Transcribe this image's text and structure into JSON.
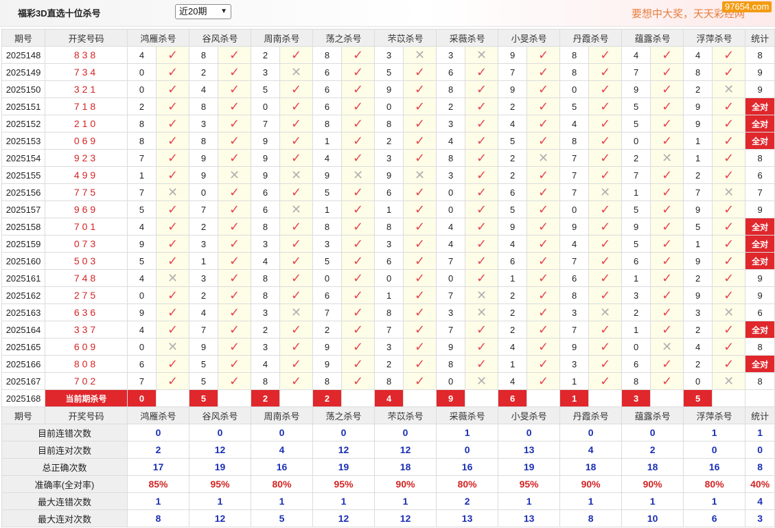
{
  "header": {
    "title": "福彩3D直选十位杀号",
    "period_select": "近20期",
    "slogan": "要想中大奖，天天彩经网",
    "site_badge": "97654.com"
  },
  "columns": {
    "period": "期号",
    "draw": "开奖号码",
    "experts": [
      "鸿雁杀号",
      "谷风杀号",
      "周南杀号",
      "荡之杀号",
      "芣苡杀号",
      "采薇杀号",
      "小旻杀号",
      "丹霞杀号",
      "蕴露杀号",
      "浮萍杀号"
    ],
    "total": "统计"
  },
  "marks": {
    "ok": "✓",
    "ng": "✕"
  },
  "rows": [
    {
      "period": "2025148",
      "draw": "838",
      "picks": [
        "4",
        "8",
        "2",
        "8",
        "3",
        "3",
        "9",
        "8",
        "4",
        "4"
      ],
      "hits": [
        1,
        1,
        1,
        1,
        0,
        0,
        1,
        1,
        1,
        1
      ],
      "total": "8"
    },
    {
      "period": "2025149",
      "draw": "734",
      "picks": [
        "0",
        "2",
        "3",
        "6",
        "5",
        "6",
        "7",
        "8",
        "7",
        "8"
      ],
      "hits": [
        1,
        1,
        0,
        1,
        1,
        1,
        1,
        1,
        1,
        1
      ],
      "total": "9"
    },
    {
      "period": "2025150",
      "draw": "321",
      "picks": [
        "0",
        "4",
        "5",
        "6",
        "9",
        "8",
        "9",
        "0",
        "9",
        "2"
      ],
      "hits": [
        1,
        1,
        1,
        1,
        1,
        1,
        1,
        1,
        1,
        0
      ],
      "total": "9"
    },
    {
      "period": "2025151",
      "draw": "718",
      "picks": [
        "2",
        "8",
        "0",
        "6",
        "0",
        "2",
        "2",
        "5",
        "5",
        "9"
      ],
      "hits": [
        1,
        1,
        1,
        1,
        1,
        1,
        1,
        1,
        1,
        1
      ],
      "total": "全对"
    },
    {
      "period": "2025152",
      "draw": "210",
      "picks": [
        "8",
        "3",
        "7",
        "8",
        "8",
        "3",
        "4",
        "4",
        "5",
        "9"
      ],
      "hits": [
        1,
        1,
        1,
        1,
        1,
        1,
        1,
        1,
        1,
        1
      ],
      "total": "全对"
    },
    {
      "period": "2025153",
      "draw": "069",
      "picks": [
        "8",
        "8",
        "9",
        "1",
        "2",
        "4",
        "5",
        "8",
        "0",
        "1"
      ],
      "hits": [
        1,
        1,
        1,
        1,
        1,
        1,
        1,
        1,
        1,
        1
      ],
      "total": "全对"
    },
    {
      "period": "2025154",
      "draw": "923",
      "picks": [
        "7",
        "9",
        "9",
        "4",
        "3",
        "8",
        "2",
        "7",
        "2",
        "1"
      ],
      "hits": [
        1,
        1,
        1,
        1,
        1,
        1,
        0,
        1,
        0,
        1
      ],
      "total": "8"
    },
    {
      "period": "2025155",
      "draw": "499",
      "picks": [
        "1",
        "9",
        "9",
        "9",
        "9",
        "3",
        "2",
        "7",
        "7",
        "2"
      ],
      "hits": [
        1,
        0,
        0,
        0,
        0,
        1,
        1,
        1,
        1,
        1
      ],
      "total": "6"
    },
    {
      "period": "2025156",
      "draw": "775",
      "picks": [
        "7",
        "0",
        "6",
        "5",
        "6",
        "0",
        "6",
        "7",
        "1",
        "7"
      ],
      "hits": [
        0,
        1,
        1,
        1,
        1,
        1,
        1,
        0,
        1,
        0
      ],
      "total": "7"
    },
    {
      "period": "2025157",
      "draw": "969",
      "picks": [
        "5",
        "7",
        "6",
        "1",
        "1",
        "0",
        "5",
        "0",
        "5",
        "9"
      ],
      "hits": [
        1,
        1,
        0,
        1,
        1,
        1,
        1,
        1,
        1,
        1
      ],
      "total": "9"
    },
    {
      "period": "2025158",
      "draw": "701",
      "picks": [
        "4",
        "2",
        "8",
        "8",
        "8",
        "4",
        "9",
        "9",
        "9",
        "5"
      ],
      "hits": [
        1,
        1,
        1,
        1,
        1,
        1,
        1,
        1,
        1,
        1
      ],
      "total": "全对"
    },
    {
      "period": "2025159",
      "draw": "073",
      "picks": [
        "9",
        "3",
        "3",
        "3",
        "3",
        "4",
        "4",
        "4",
        "5",
        "1"
      ],
      "hits": [
        1,
        1,
        1,
        1,
        1,
        1,
        1,
        1,
        1,
        1
      ],
      "total": "全对"
    },
    {
      "period": "2025160",
      "draw": "503",
      "picks": [
        "5",
        "1",
        "4",
        "5",
        "6",
        "7",
        "6",
        "7",
        "6",
        "9"
      ],
      "hits": [
        1,
        1,
        1,
        1,
        1,
        1,
        1,
        1,
        1,
        1
      ],
      "total": "全对"
    },
    {
      "period": "2025161",
      "draw": "748",
      "picks": [
        "4",
        "3",
        "8",
        "0",
        "0",
        "0",
        "1",
        "6",
        "1",
        "2"
      ],
      "hits": [
        0,
        1,
        1,
        1,
        1,
        1,
        1,
        1,
        1,
        1
      ],
      "total": "9"
    },
    {
      "period": "2025162",
      "draw": "275",
      "picks": [
        "0",
        "2",
        "8",
        "6",
        "1",
        "7",
        "2",
        "8",
        "3",
        "9"
      ],
      "hits": [
        1,
        1,
        1,
        1,
        1,
        0,
        1,
        1,
        1,
        1
      ],
      "total": "9"
    },
    {
      "period": "2025163",
      "draw": "636",
      "picks": [
        "9",
        "4",
        "3",
        "7",
        "8",
        "3",
        "2",
        "3",
        "2",
        "3"
      ],
      "hits": [
        1,
        1,
        0,
        1,
        1,
        0,
        1,
        0,
        1,
        0
      ],
      "total": "6"
    },
    {
      "period": "2025164",
      "draw": "337",
      "picks": [
        "4",
        "7",
        "2",
        "2",
        "7",
        "7",
        "2",
        "7",
        "1",
        "2"
      ],
      "hits": [
        1,
        1,
        1,
        1,
        1,
        1,
        1,
        1,
        1,
        1
      ],
      "total": "全对"
    },
    {
      "period": "2025165",
      "draw": "609",
      "picks": [
        "0",
        "9",
        "3",
        "9",
        "3",
        "9",
        "4",
        "9",
        "0",
        "4"
      ],
      "hits": [
        0,
        1,
        1,
        1,
        1,
        1,
        1,
        1,
        0,
        1
      ],
      "total": "8"
    },
    {
      "period": "2025166",
      "draw": "808",
      "picks": [
        "6",
        "5",
        "4",
        "9",
        "2",
        "8",
        "1",
        "3",
        "6",
        "2"
      ],
      "hits": [
        1,
        1,
        1,
        1,
        1,
        1,
        1,
        1,
        1,
        1
      ],
      "total": "全对"
    },
    {
      "period": "2025167",
      "draw": "702",
      "picks": [
        "7",
        "5",
        "8",
        "8",
        "8",
        "0",
        "4",
        "1",
        "8",
        "0"
      ],
      "hits": [
        1,
        1,
        1,
        1,
        1,
        0,
        1,
        1,
        1,
        0
      ],
      "total": "8"
    }
  ],
  "current": {
    "period": "2025168",
    "label": "当前期杀号",
    "picks": [
      "0",
      "5",
      "2",
      "2",
      "4",
      "9",
      "6",
      "1",
      "3",
      "5"
    ]
  },
  "stats": [
    {
      "label": "目前连错次数",
      "values": [
        "0",
        "0",
        "0",
        "0",
        "0",
        "1",
        "0",
        "0",
        "0",
        "1"
      ],
      "total": "1"
    },
    {
      "label": "目前连对次数",
      "values": [
        "2",
        "12",
        "4",
        "12",
        "12",
        "0",
        "13",
        "4",
        "2",
        "0"
      ],
      "total": "0"
    },
    {
      "label": "总正确次数",
      "values": [
        "17",
        "19",
        "16",
        "19",
        "18",
        "16",
        "19",
        "18",
        "18",
        "16"
      ],
      "total": "8"
    },
    {
      "label": "准确率(全对率)",
      "values": [
        "85%",
        "95%",
        "80%",
        "95%",
        "90%",
        "80%",
        "95%",
        "90%",
        "90%",
        "80%"
      ],
      "total": "40%",
      "rate": true
    },
    {
      "label": "最大连错次数",
      "values": [
        "1",
        "1",
        "1",
        "1",
        "1",
        "2",
        "1",
        "1",
        "1",
        "1"
      ],
      "total": "4"
    },
    {
      "label": "最大连对次数",
      "values": [
        "8",
        "12",
        "5",
        "12",
        "12",
        "13",
        "13",
        "8",
        "10",
        "6"
      ],
      "total": "3"
    }
  ]
}
